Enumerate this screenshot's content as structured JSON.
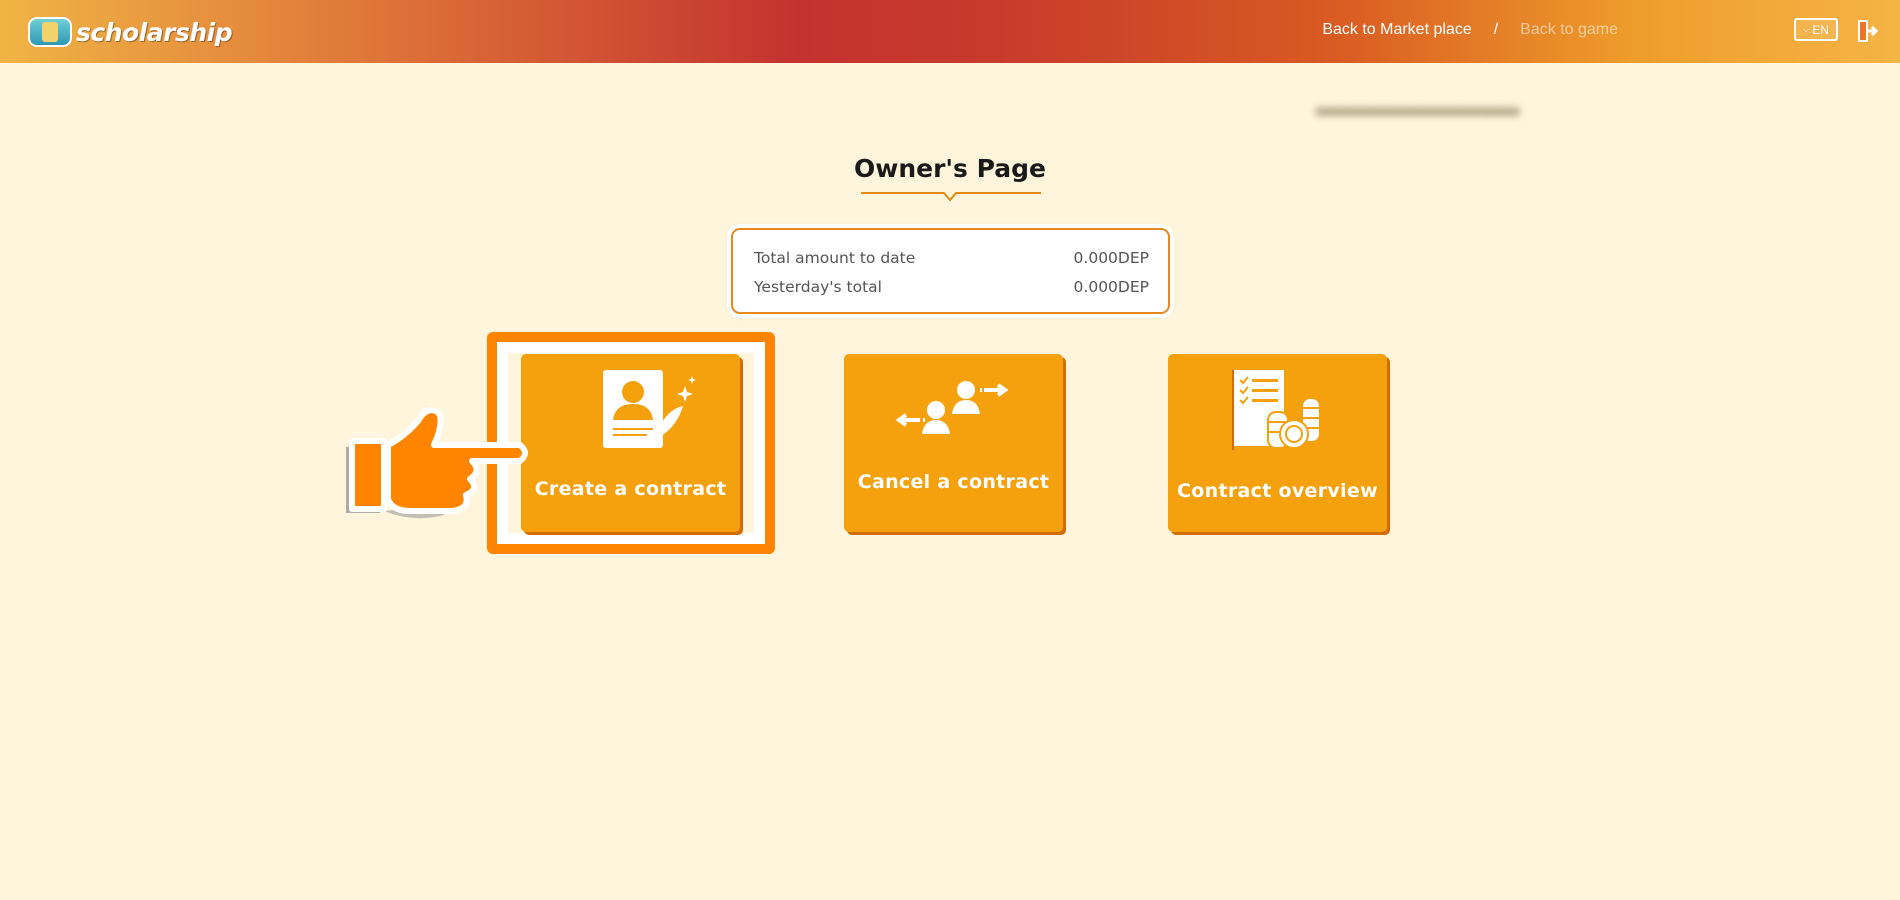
{
  "header": {
    "logo_text": "scholarship",
    "nav": {
      "market_label": "Back to Market place",
      "separator": "/",
      "game_label": "Back to game"
    },
    "language": "EN",
    "icons": {
      "logo": "scholarship-logo-icon",
      "language_dropdown": "chevron-down-icon",
      "logout": "logout-icon"
    }
  },
  "page": {
    "title": "Owner's Page"
  },
  "summary": {
    "rows": [
      {
        "label": "Total amount to date",
        "value": "0.000DEP"
      },
      {
        "label": "Yesterday's total",
        "value": "0.000DEP"
      }
    ]
  },
  "cards": [
    {
      "label": "Create a contract",
      "icon": "contract-signing-icon",
      "highlighted": true
    },
    {
      "label": "Cancel a contract",
      "icon": "users-exchange-icon",
      "highlighted": false
    },
    {
      "label": "Contract overview",
      "icon": "document-coins-icon",
      "highlighted": false
    }
  ],
  "colors": {
    "background": "#fff5dc",
    "card": "#f5a10d",
    "card_shadow": "#d26b00",
    "highlight": "#ff8500",
    "summary_border": "#e8891f"
  }
}
